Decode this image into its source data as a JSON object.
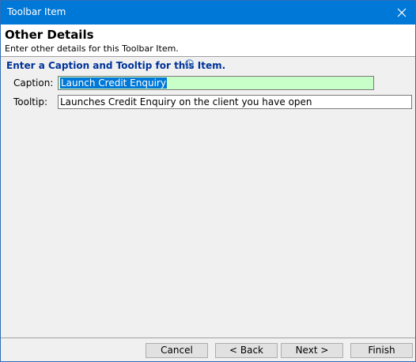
{
  "window": {
    "title": "Toolbar Item"
  },
  "header": {
    "title": "Other Details",
    "subtitle": "Enter other details for this Toolbar Item."
  },
  "group": {
    "title": "Enter a Caption and Tooltip for this Item."
  },
  "fields": {
    "caption": {
      "label": "Caption:",
      "value": "Launch Credit Enquiry"
    },
    "tooltip": {
      "label": "Tooltip:",
      "value": "Launches Credit Enquiry on the client you have open"
    }
  },
  "buttons": {
    "cancel": "Cancel",
    "back": "< Back",
    "next": "Next >",
    "finish": "Finish"
  },
  "colors": {
    "titlebar": "#0078d7",
    "caption_bg": "#c8ffc8",
    "selection": "#0078d7",
    "group_title": "#003399"
  },
  "icons": {
    "close": "close-icon",
    "info": "info-icon"
  }
}
